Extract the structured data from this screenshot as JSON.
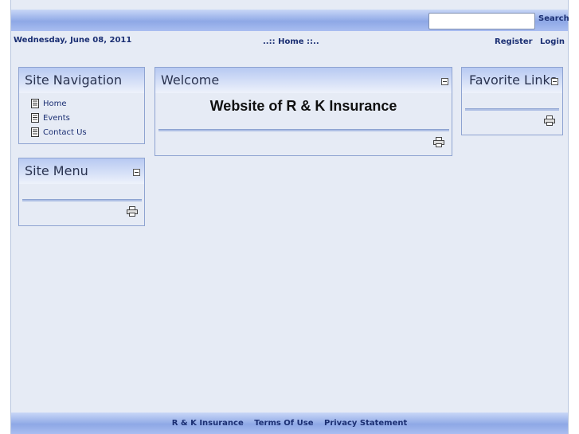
{
  "header": {
    "search_label": "Search",
    "search_value": "",
    "search_placeholder": ""
  },
  "infobar": {
    "date": "Wednesday, June 08, 2011",
    "crumb_prefix": "..::",
    "crumb_link": "Home",
    "crumb_suffix": "::..",
    "register": "Register",
    "login": "Login"
  },
  "site_navigation": {
    "title": "Site Navigation",
    "items": [
      "Home",
      "Events",
      "Contact Us"
    ]
  },
  "site_menu": {
    "title": "Site Menu"
  },
  "welcome": {
    "title": "Welcome",
    "body": "Website of R & K Insurance"
  },
  "favorite_links": {
    "title": "Favorite Links"
  },
  "footer": {
    "company": "R & K Insurance",
    "terms": "Terms Of Use",
    "privacy": "Privacy Statement"
  },
  "colors": {
    "link": "#1b2f73",
    "band": "#8ea8e6",
    "background": "#e6ebf5"
  },
  "icons": [
    "document-icon",
    "minimize-icon",
    "print-icon"
  ]
}
